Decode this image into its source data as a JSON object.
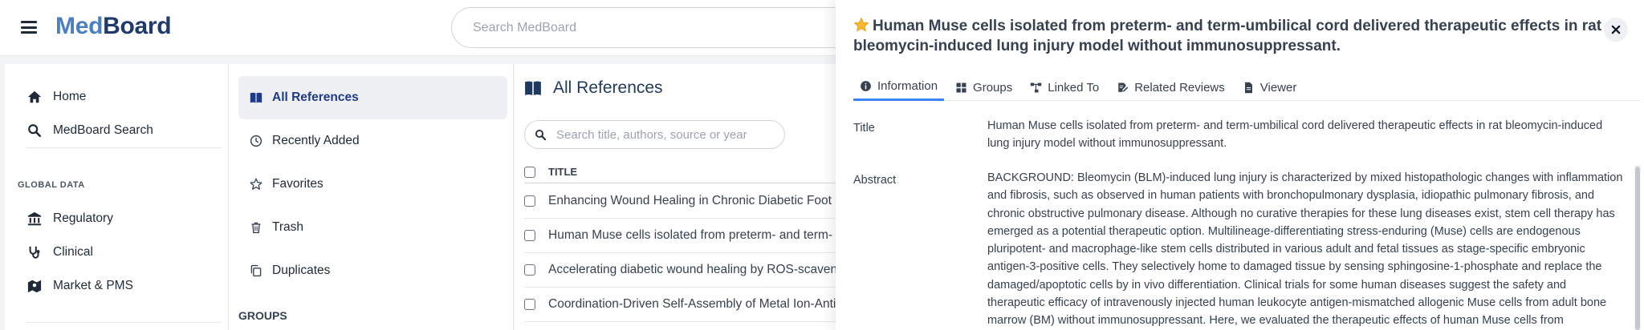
{
  "app": {
    "logo_part1": "Med",
    "logo_part2": "Board",
    "search_placeholder": "Search MedBoard"
  },
  "sidebar": {
    "items": [
      {
        "label": "Home",
        "icon": "home-icon"
      },
      {
        "label": "MedBoard Search",
        "icon": "search-icon"
      }
    ],
    "global_data_label": "GLOBAL DATA",
    "global_items": [
      {
        "label": "Regulatory",
        "icon": "bank-icon"
      },
      {
        "label": "Clinical",
        "icon": "stethoscope-icon"
      },
      {
        "label": "Market & PMS",
        "icon": "map-users-icon"
      }
    ]
  },
  "references_nav": {
    "items": [
      {
        "label": "All References",
        "icon": "book-icon",
        "active": true
      },
      {
        "label": "Recently Added",
        "icon": "clock-icon"
      },
      {
        "label": "Favorites",
        "icon": "star-icon"
      },
      {
        "label": "Trash",
        "icon": "trash-icon"
      },
      {
        "label": "Duplicates",
        "icon": "duplicate-icon"
      }
    ],
    "groups_label": "GROUPS"
  },
  "main": {
    "title": "All References",
    "search_placeholder": "Search title, authors, source or year",
    "column_title": "TITLE",
    "rows": [
      "Enhancing Wound Healing in Chronic Diabetic Foot U",
      "Human Muse cells isolated from preterm- and term-",
      "Accelerating diabetic wound healing by ROS-scaveng",
      "Coordination-Driven Self-Assembly of Metal Ion-Anti"
    ]
  },
  "panel": {
    "title": "Human Muse cells isolated from preterm- and term-umbilical cord delivered therapeutic effects in rat bleomycin-induced lung injury model without immunosuppressant.",
    "tabs": [
      {
        "label": "Information",
        "icon": "info-icon",
        "active": true
      },
      {
        "label": "Groups",
        "icon": "grid-icon"
      },
      {
        "label": "Linked To",
        "icon": "hierarchy-icon"
      },
      {
        "label": "Related Reviews",
        "icon": "edit-doc-icon"
      },
      {
        "label": "Viewer",
        "icon": "file-icon"
      }
    ],
    "title_label": "Title",
    "title_value": "Human Muse cells isolated from preterm- and term-umbilical cord delivered therapeutic effects in rat bleomycin-induced lung injury model without immunosuppressant.",
    "abstract_label": "Abstract",
    "abstract_value": "BACKGROUND: Bleomycin (BLM)-induced lung injury is characterized by mixed histopathologic changes with inflammation and fibrosis, such as observed in human patients with bronchopulmonary dysplasia, idiopathic pulmonary fibrosis, and chronic obstructive pulmonary disease. Although no curative therapies for these lung diseases exist, stem cell therapy has emerged as a potential therapeutic option. Multilineage-differentiating stress-enduring (Muse) cells are endogenous pluripotent- and macrophage-like stem cells distributed in various adult and fetal tissues as stage-specific embryonic antigen-3-positive cells. They selectively home to damaged tissue by sensing sphingosine-1-phosphate and replace the damaged/apoptotic cells by in vivo differentiation. Clinical trials for some human diseases suggest the safety and therapeutic efficacy of intravenously injected human leukocyte antigen-mismatched allogenic Muse cells from adult bone marrow (BM) without immunosuppressant. Here, we evaluated the therapeutic effects of human Muse cells from"
  },
  "colors": {
    "logo_light": "#4a7fc1",
    "logo_dark": "#1f3a6b",
    "active_tab": "#3b82f6",
    "active_nav_text": "#1e3a8a",
    "star": "#f5b82e"
  }
}
